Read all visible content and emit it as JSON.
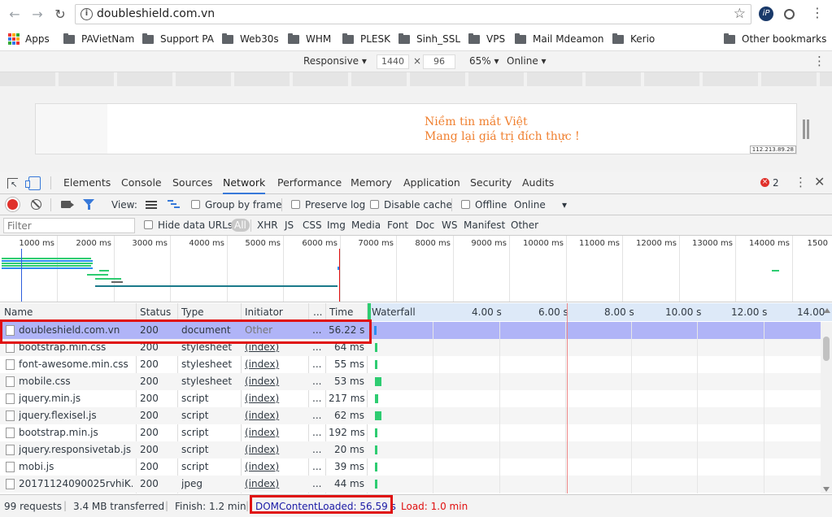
{
  "browser": {
    "url": "doubleshield.com.vn",
    "bookmarks": [
      "Apps",
      "PAVietNam",
      "Support PA",
      "Web30s",
      "WHM",
      "PLESK",
      "Sinh_SSL",
      "VPS",
      "Mail Mdeamon",
      "Kerio"
    ],
    "other_bookmarks": "Other bookmarks"
  },
  "device_toolbar": {
    "device": "Responsive",
    "width": "1440",
    "x": "×",
    "height": "96",
    "zoom": "65%",
    "network": "Online"
  },
  "page": {
    "slogan_line1": "Niềm tin mắt Việt",
    "slogan_line2": "Mang lại giá trị đích thực !",
    "ip": "112.213.89.28"
  },
  "devtools": {
    "tabs": [
      "Elements",
      "Console",
      "Sources",
      "Network",
      "Performance",
      "Memory",
      "Application",
      "Security",
      "Audits"
    ],
    "active_tab": "Network",
    "error_count": "2"
  },
  "network_toolbar": {
    "view_label": "View:",
    "group_by_frame": "Group by frame",
    "preserve_log": "Preserve log",
    "disable_cache": "Disable cache",
    "offline": "Offline",
    "throttle": "Online"
  },
  "filter": {
    "placeholder": "Filter",
    "hide_data_urls": "Hide data URLs",
    "types": [
      "All",
      "XHR",
      "JS",
      "CSS",
      "Img",
      "Media",
      "Font",
      "Doc",
      "WS",
      "Manifest",
      "Other"
    ]
  },
  "overview_ticks": [
    "1000 ms",
    "2000 ms",
    "3000 ms",
    "4000 ms",
    "5000 ms",
    "6000 ms",
    "7000 ms",
    "8000 ms",
    "9000 ms",
    "10000 ms",
    "11000 ms",
    "12000 ms",
    "13000 ms",
    "14000 ms",
    "1500"
  ],
  "table": {
    "headers": {
      "name": "Name",
      "status": "Status",
      "type": "Type",
      "initiator": "Initiator",
      "size": "...",
      "time": "Time",
      "waterfall": "Waterfall"
    },
    "waterfall_ticks": [
      "4.00 s",
      "6.00 s",
      "8.00 s",
      "10.00 s",
      "12.00 s",
      "14.00"
    ],
    "rows": [
      {
        "name": "doubleshield.com.vn",
        "status": "200",
        "type": "document",
        "initiator": "Other",
        "size": "...",
        "time": "56.22 s",
        "wf_start": 0.005,
        "wf_len": 0.0,
        "wf_color": "#2d8cf0"
      },
      {
        "name": "bootstrap.min.css",
        "status": "200",
        "type": "stylesheet",
        "initiator": "(index)",
        "size": "...",
        "time": "64 ms",
        "wf_start": 0.007,
        "wf_len": 0.004,
        "wf_color": "#2ecc71"
      },
      {
        "name": "font-awesome.min.css",
        "status": "200",
        "type": "stylesheet",
        "initiator": "(index)",
        "size": "...",
        "time": "55 ms",
        "wf_start": 0.007,
        "wf_len": 0.004,
        "wf_color": "#2ecc71"
      },
      {
        "name": "mobile.css",
        "status": "200",
        "type": "stylesheet",
        "initiator": "(index)",
        "size": "...",
        "time": "53 ms",
        "wf_start": 0.007,
        "wf_len": 0.014,
        "wf_color": "#2ecc71"
      },
      {
        "name": "jquery.min.js",
        "status": "200",
        "type": "script",
        "initiator": "(index)",
        "size": "...",
        "time": "217 ms",
        "wf_start": 0.007,
        "wf_len": 0.008,
        "wf_color": "#2ecc71"
      },
      {
        "name": "jquery.flexisel.js",
        "status": "200",
        "type": "script",
        "initiator": "(index)",
        "size": "...",
        "time": "62 ms",
        "wf_start": 0.007,
        "wf_len": 0.014,
        "wf_color": "#2ecc71"
      },
      {
        "name": "bootstrap.min.js",
        "status": "200",
        "type": "script",
        "initiator": "(index)",
        "size": "...",
        "time": "192 ms",
        "wf_start": 0.007,
        "wf_len": 0.003,
        "wf_color": "#2ecc71"
      },
      {
        "name": "jquery.responsivetab.js",
        "status": "200",
        "type": "script",
        "initiator": "(index)",
        "size": "...",
        "time": "20 ms",
        "wf_start": 0.007,
        "wf_len": 0.003,
        "wf_color": "#2ecc71"
      },
      {
        "name": "mobi.js",
        "status": "200",
        "type": "script",
        "initiator": "(index)",
        "size": "...",
        "time": "39 ms",
        "wf_start": 0.007,
        "wf_len": 0.003,
        "wf_color": "#2ecc71"
      },
      {
        "name": "20171124090025rvhiK...",
        "status": "200",
        "type": "jpeg",
        "initiator": "(index)",
        "size": "...",
        "time": "44 ms",
        "wf_start": 0.007,
        "wf_len": 0.003,
        "wf_color": "#2ecc71"
      }
    ]
  },
  "status": {
    "requests": "99 requests",
    "transferred": "3.4 MB transferred",
    "finish": "Finish: 1.2 min",
    "dom_content_loaded": "DOMContentLoaded: 56.59 s",
    "load": "Load: 1.0 min"
  },
  "colors": {
    "accent": "#3879d9",
    "dcl": "#1a1aa6",
    "load": "#e01010",
    "highlight": "#e01010",
    "selected_row": "#b0b4f7"
  }
}
